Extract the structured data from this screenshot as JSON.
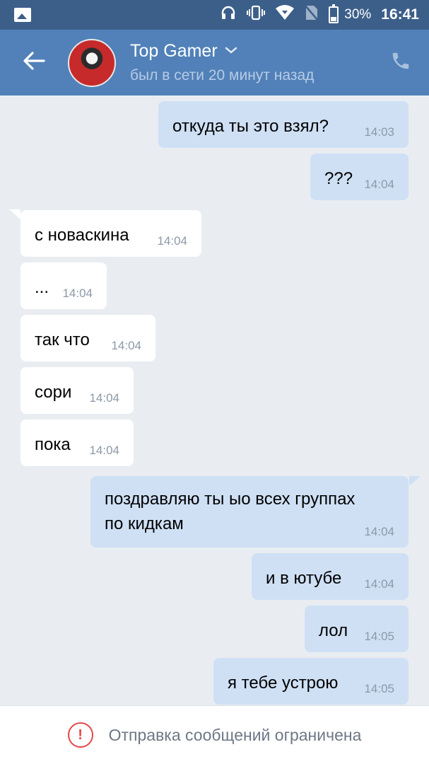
{
  "status_bar": {
    "battery": "30%",
    "time": "16:41",
    "icons": [
      "gallery-icon",
      "headphones-icon",
      "vibrate-icon",
      "wifi-icon",
      "no-sim-icon",
      "battery-icon"
    ]
  },
  "header": {
    "contact_name": "Top Gamer",
    "last_seen": "был в сети 20 минут назад",
    "icons": [
      "back-arrow-icon",
      "chevron-down-icon",
      "phone-icon"
    ],
    "colors": {
      "header_bg": "#5181b8",
      "status_bg": "#3c5f8a"
    }
  },
  "messages": [
    {
      "dir": "out",
      "text": "откуда ты это взял?",
      "time": "14:03"
    },
    {
      "dir": "out",
      "text": "???",
      "time": "14:04"
    },
    {
      "dir": "in",
      "text": "с новаскина",
      "time": "14:04"
    },
    {
      "dir": "in",
      "text": "...",
      "time": "14:04"
    },
    {
      "dir": "in",
      "text": "так что",
      "time": "14:04"
    },
    {
      "dir": "in",
      "text": "сори",
      "time": "14:04"
    },
    {
      "dir": "in",
      "text": "пока",
      "time": "14:04"
    },
    {
      "dir": "out",
      "text_line1": "поздравляю ты ыо всех группах",
      "text_line2": "по кидкам",
      "time": "14:04"
    },
    {
      "dir": "out",
      "text": "и в ютубе",
      "time": "14:04"
    },
    {
      "dir": "out",
      "text": "лол",
      "time": "14:05"
    },
    {
      "dir": "out",
      "text": "я тебе устрою",
      "time": "14:05"
    }
  ],
  "footer": {
    "restricted_text": "Отправка сообщений ограничена",
    "icon": "alert-circle-icon",
    "alert_color": "#e64646"
  }
}
